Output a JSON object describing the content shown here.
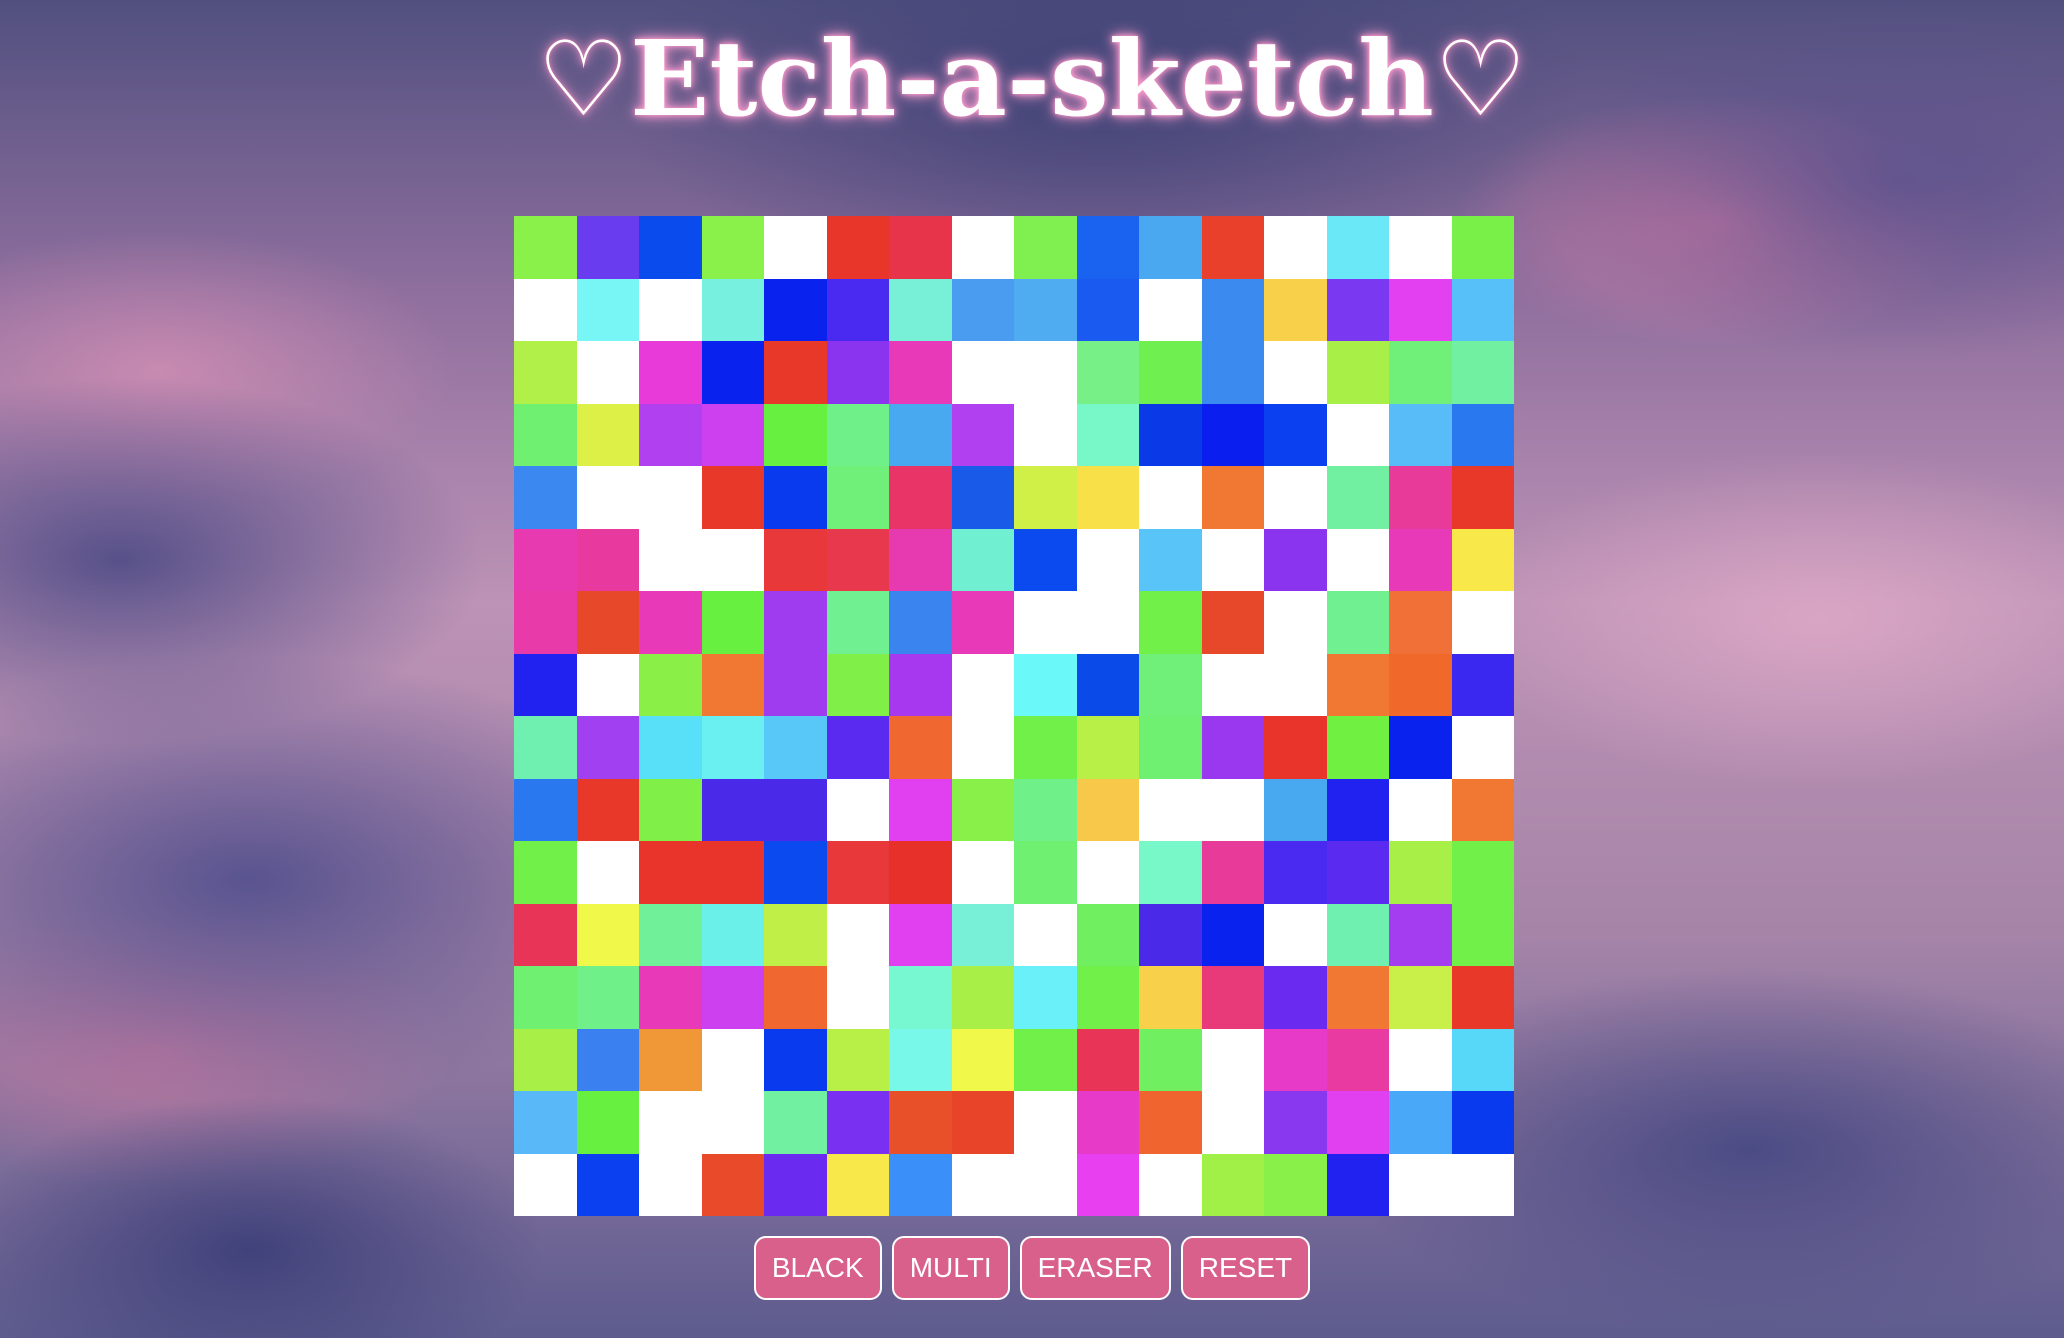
{
  "header": {
    "title": "♡Etch-a-sketch♡"
  },
  "controls": {
    "black": "BLACK",
    "multi": "MULTI",
    "eraser": "ERASER",
    "reset": "RESET"
  },
  "grid": {
    "rows": 16,
    "cols": 16,
    "cells": [
      [
        "#8af04a",
        "#6a3cf0",
        "#0a4bee",
        "#8af04a",
        "#ffffff",
        "#e8362a",
        "#e8344a",
        "#ffffff",
        "#80f050",
        "#1a62f0",
        "#4aa8f0",
        "#e8402a",
        "#ffffff",
        "#6ae8f8",
        "#ffffff",
        "#78f048"
      ],
      [
        "#ffffff",
        "#78f6f6",
        "#ffffff",
        "#78f0e0",
        "#0a22ee",
        "#4a2af0",
        "#78f0d8",
        "#4a9cf0",
        "#50acf0",
        "#1a5af0",
        "#ffffff",
        "#3a8af0",
        "#f8d04a",
        "#7a38f0",
        "#e240f0",
        "#58c0f8"
      ],
      [
        "#b0f048",
        "#ffffff",
        "#e83ad8",
        "#0a22ee",
        "#e8382a",
        "#8a34f0",
        "#e83ab8",
        "#ffffff",
        "#ffffff",
        "#78f088",
        "#70f050",
        "#3a8af0",
        "#ffffff",
        "#a8f048",
        "#70f078",
        "#70f0a0"
      ],
      [
        "#70f070",
        "#dcf048",
        "#b040f0",
        "#cc40f0",
        "#68f040",
        "#70f088",
        "#48a8f0",
        "#b040f0",
        "#ffffff",
        "#78f8c8",
        "#0a3ae8",
        "#0a1ef0",
        "#0a40f0",
        "#ffffff",
        "#58bcf8",
        "#2a78f0"
      ],
      [
        "#3a88f0",
        "#ffffff",
        "#ffffff",
        "#e8382a",
        "#0a3aee",
        "#70f078",
        "#e83466",
        "#1a5ae8",
        "#d0f048",
        "#f8e048",
        "#ffffff",
        "#f07832",
        "#ffffff",
        "#70f0a0",
        "#e83a98",
        "#e8382a"
      ],
      [
        "#e83ab0",
        "#e83a9e",
        "#ffffff",
        "#ffffff",
        "#e8383a",
        "#e8384e",
        "#e83ab0",
        "#70f0d0",
        "#0a4aee",
        "#ffffff",
        "#58c4f8",
        "#ffffff",
        "#8a34f0",
        "#ffffff",
        "#e83ab8",
        "#f8e84a"
      ],
      [
        "#e83aa8",
        "#e8482a",
        "#e83ab8",
        "#68f040",
        "#a03cf0",
        "#70f090",
        "#3a84f0",
        "#e83ab8",
        "#ffffff",
        "#ffffff",
        "#70f048",
        "#e8482a",
        "#ffffff",
        "#70f090",
        "#f07038",
        "#ffffff"
      ],
      [
        "#2222f0",
        "#ffffff",
        "#8af048",
        "#f07832",
        "#a03cf0",
        "#80f048",
        "#a838f0",
        "#ffffff",
        "#6af8f8",
        "#0a4ae8",
        "#70f078",
        "#ffffff",
        "#ffffff",
        "#f07832",
        "#f0682a",
        "#3a28f0"
      ],
      [
        "#70f0b0",
        "#a040f0",
        "#58e0f8",
        "#6af0f0",
        "#58c8f8",
        "#5a2af0",
        "#f06830",
        "#ffffff",
        "#70f048",
        "#b8f048",
        "#70f070",
        "#9a38f0",
        "#e8342a",
        "#70f040",
        "#0a22ee",
        "#ffffff"
      ],
      [
        "#2a78f0",
        "#e8382a",
        "#80f048",
        "#4a2ae8",
        "#4a2ae8",
        "#ffffff",
        "#e040f0",
        "#88f048",
        "#70f088",
        "#f8c84a",
        "#ffffff",
        "#ffffff",
        "#48a8f0",
        "#2222f0",
        "#ffffff",
        "#f07832"
      ],
      [
        "#70f048",
        "#ffffff",
        "#e8342a",
        "#e8342a",
        "#0a4aee",
        "#e8383a",
        "#e8302a",
        "#ffffff",
        "#70f070",
        "#ffffff",
        "#78f8c8",
        "#e83a98",
        "#4a2af0",
        "#5a2af0",
        "#a8f048",
        "#70f048"
      ],
      [
        "#e83456",
        "#f0f84a",
        "#70f098",
        "#6af0e8",
        "#c0f048",
        "#ffffff",
        "#e040f0",
        "#78f0d8",
        "#ffffff",
        "#70f060",
        "#4a2ae8",
        "#0a22ee",
        "#ffffff",
        "#70f0b0",
        "#a43cf0",
        "#70f048"
      ],
      [
        "#70f070",
        "#70f088",
        "#e83ab8",
        "#cc40f0",
        "#f06830",
        "#ffffff",
        "#78f8d0",
        "#a8f048",
        "#6af0f8",
        "#70f048",
        "#f8d04a",
        "#e83a78",
        "#6a2af0",
        "#f07832",
        "#c8f048",
        "#e8382a"
      ],
      [
        "#a8f048",
        "#3a80f0",
        "#f09838",
        "#ffffff",
        "#0a3aee",
        "#b8f048",
        "#78f8e8",
        "#f0f84a",
        "#70f048",
        "#e83456",
        "#70f060",
        "#ffffff",
        "#e83ac8",
        "#e83aa0",
        "#ffffff",
        "#58d8f8"
      ],
      [
        "#58b8f8",
        "#68f040",
        "#ffffff",
        "#ffffff",
        "#70f0a0",
        "#7a30f0",
        "#e8502a",
        "#e8442a",
        "#ffffff",
        "#e83ac8",
        "#f06430",
        "#ffffff",
        "#8a38f0",
        "#e040f0",
        "#4aa8f8",
        "#0a3aee"
      ],
      [
        "#ffffff",
        "#0a40f0",
        "#ffffff",
        "#e84a2a",
        "#6a2af0",
        "#f8e84a",
        "#3a90f8",
        "#ffffff",
        "#ffffff",
        "#e840f0",
        "#ffffff",
        "#a0f048",
        "#88f048",
        "#2222f0",
        "#ffffff",
        "#ffffff"
      ]
    ]
  }
}
